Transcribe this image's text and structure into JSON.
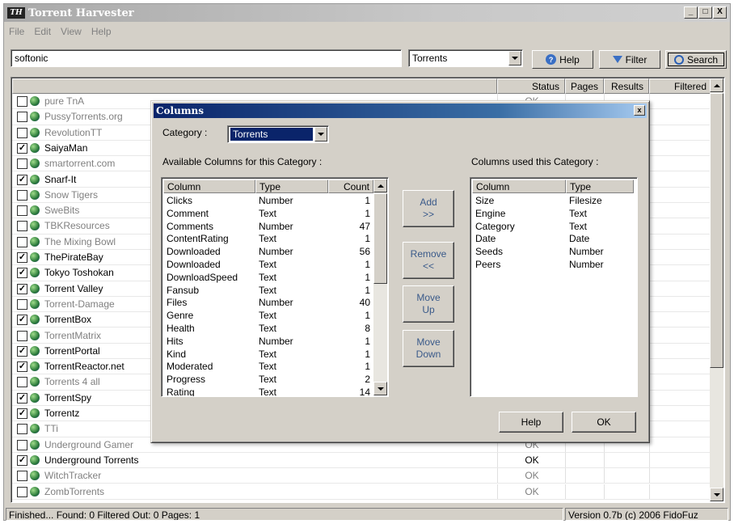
{
  "window": {
    "title": "Torrent Harvester",
    "logo": "TH",
    "controls": [
      "_",
      "□",
      "X"
    ]
  },
  "menu": [
    "File",
    "Edit",
    "View",
    "Help"
  ],
  "toolbar": {
    "search_value": "softonic",
    "type_value": "Torrents",
    "help_label": "Help",
    "filter_label": "Filter",
    "search_label": "Search"
  },
  "list": {
    "headers": [
      "Status",
      "Pages",
      "Results",
      "Filtered"
    ],
    "rows": [
      {
        "name": "pure TnA",
        "checked": false,
        "dim": true,
        "status": "OK"
      },
      {
        "name": "PussyTorrents.org",
        "checked": false,
        "dim": true,
        "status": ""
      },
      {
        "name": "RevolutionTT",
        "checked": false,
        "dim": true,
        "status": ""
      },
      {
        "name": "SaiyaMan",
        "checked": true,
        "dim": false,
        "status": ""
      },
      {
        "name": "smartorrent.com",
        "checked": false,
        "dim": true,
        "status": ""
      },
      {
        "name": "Snarf-It",
        "checked": true,
        "dim": false,
        "status": ""
      },
      {
        "name": "Snow Tigers",
        "checked": false,
        "dim": true,
        "status": ""
      },
      {
        "name": "SweBits",
        "checked": false,
        "dim": true,
        "status": ""
      },
      {
        "name": "TBKResources",
        "checked": false,
        "dim": true,
        "status": ""
      },
      {
        "name": "The Mixing Bowl",
        "checked": false,
        "dim": true,
        "status": ""
      },
      {
        "name": "ThePirateBay",
        "checked": true,
        "dim": false,
        "status": ""
      },
      {
        "name": "Tokyo Toshokan",
        "checked": true,
        "dim": false,
        "status": ""
      },
      {
        "name": "Torrent Valley",
        "checked": true,
        "dim": false,
        "status": ""
      },
      {
        "name": "Torrent-Damage",
        "checked": false,
        "dim": true,
        "status": ""
      },
      {
        "name": "TorrentBox",
        "checked": true,
        "dim": false,
        "status": ""
      },
      {
        "name": "TorrentMatrix",
        "checked": false,
        "dim": true,
        "status": ""
      },
      {
        "name": "TorrentPortal",
        "checked": true,
        "dim": false,
        "status": ""
      },
      {
        "name": "TorrentReactor.net",
        "checked": true,
        "dim": false,
        "status": ""
      },
      {
        "name": "Torrents 4 all",
        "checked": false,
        "dim": true,
        "status": ""
      },
      {
        "name": "TorrentSpy",
        "checked": true,
        "dim": false,
        "status": ""
      },
      {
        "name": "Torrentz",
        "checked": true,
        "dim": false,
        "status": ""
      },
      {
        "name": "TTi",
        "checked": false,
        "dim": true,
        "status": ""
      },
      {
        "name": "Underground Gamer",
        "checked": false,
        "dim": true,
        "status": "OK"
      },
      {
        "name": "Underground Torrents",
        "checked": true,
        "dim": false,
        "status": "OK"
      },
      {
        "name": "WitchTracker",
        "checked": false,
        "dim": true,
        "status": "OK"
      },
      {
        "name": "ZombTorrents",
        "checked": false,
        "dim": true,
        "status": "OK"
      }
    ]
  },
  "statusbar": {
    "left": "Finished... Found: 0 Filtered Out: 0 Pages: 1",
    "right": "Version 0.7b (c) 2006 FidoFuz"
  },
  "dialog": {
    "title": "Columns",
    "close": "x",
    "category_label": "Category :",
    "category_value": "Torrents",
    "available_label": "Available Columns for this Category :",
    "used_label": "Columns used this Category :",
    "available_headers": [
      "Column",
      "Type",
      "Count"
    ],
    "available_rows": [
      [
        "Clicks",
        "Number",
        "1"
      ],
      [
        "Comment",
        "Text",
        "1"
      ],
      [
        "Comments",
        "Number",
        "47"
      ],
      [
        "ContentRating",
        "Text",
        "1"
      ],
      [
        "Downloaded",
        "Number",
        "56"
      ],
      [
        "Downloaded",
        "Text",
        "1"
      ],
      [
        "DownloadSpeed",
        "Text",
        "1"
      ],
      [
        "Fansub",
        "Text",
        "1"
      ],
      [
        "Files",
        "Number",
        "40"
      ],
      [
        "Genre",
        "Text",
        "1"
      ],
      [
        "Health",
        "Text",
        "8"
      ],
      [
        "Hits",
        "Number",
        "1"
      ],
      [
        "Kind",
        "Text",
        "1"
      ],
      [
        "Moderated",
        "Text",
        "1"
      ],
      [
        "Progress",
        "Text",
        "2"
      ],
      [
        "Rating",
        "Text",
        "14"
      ]
    ],
    "used_headers": [
      "Column",
      "Type"
    ],
    "used_rows": [
      [
        "Size",
        "Filesize"
      ],
      [
        "Engine",
        "Text"
      ],
      [
        "Category",
        "Text"
      ],
      [
        "Date",
        "Date"
      ],
      [
        "Seeds",
        "Number"
      ],
      [
        "Peers",
        "Number"
      ]
    ],
    "add_label": "Add\n>>",
    "remove_label": "Remove\n<<",
    "move_up_label": "Move\nUp",
    "move_down_label": "Move\nDown",
    "help_label": "Help",
    "ok_label": "OK"
  }
}
